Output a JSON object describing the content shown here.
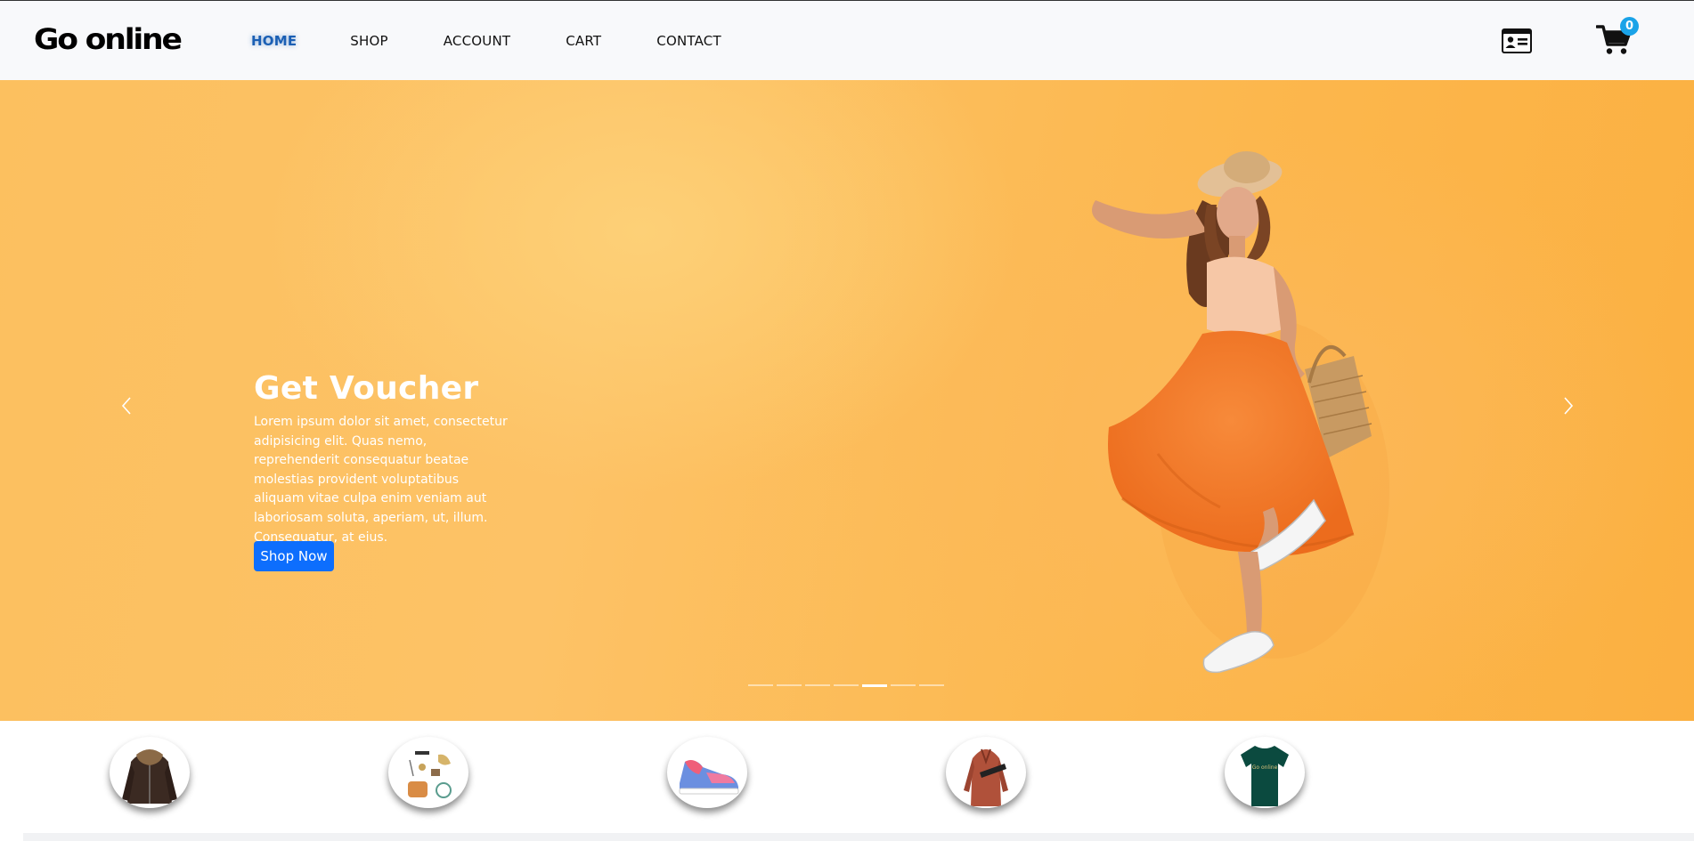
{
  "brand": {
    "logo_text": "Go online"
  },
  "nav": {
    "items": [
      {
        "label": "HOME",
        "active": true
      },
      {
        "label": "SHOP",
        "active": false
      },
      {
        "label": "ACCOUNT",
        "active": false
      },
      {
        "label": "CART",
        "active": false
      },
      {
        "label": "CONTACT",
        "active": false
      }
    ],
    "active_color": "#1a5fb4"
  },
  "header_icons": {
    "profile_icon": "id-card-icon",
    "cart_icon": "shopping-cart-icon",
    "cart_count": "0",
    "badge_color": "#1aa3e8"
  },
  "hero": {
    "title": "Get Voucher",
    "text": "Lorem ipsum dolor sit amet, consectetur adipisicing elit. Quas nemo, reprehenderit consequatur beatae molestias provident voluptatibus aliquam vitae culpa enim veniam aut laboriosam soluta, aperiam, ut, illum. Consequatur, at eius.",
    "button_label": "Shop Now",
    "button_color": "#0d6efd",
    "background_color": "#fcba52",
    "slides_count": 7,
    "active_slide": 5
  },
  "categories": [
    {
      "icon": "leather-jacket-image"
    },
    {
      "icon": "accessories-image"
    },
    {
      "icon": "sneaker-image"
    },
    {
      "icon": "coat-image"
    },
    {
      "icon": "tshirt-image",
      "label": "Go online"
    }
  ]
}
